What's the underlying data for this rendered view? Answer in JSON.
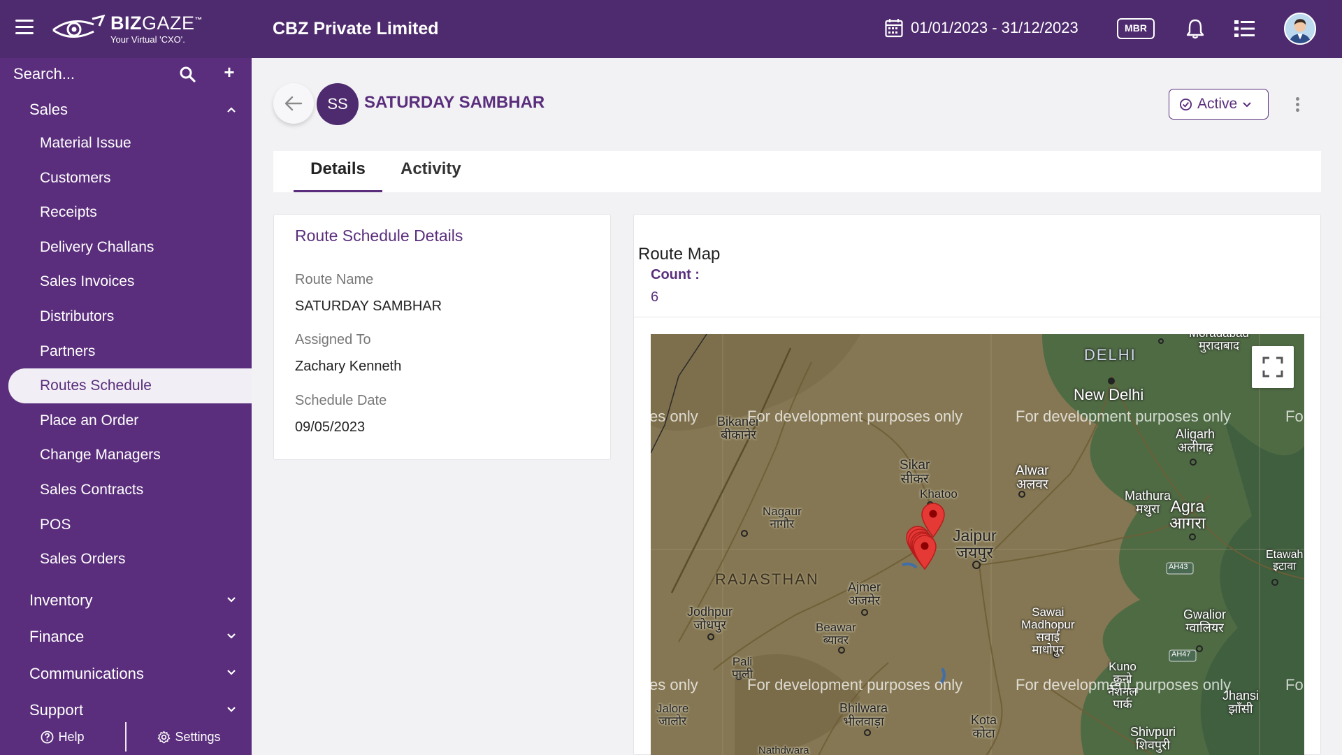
{
  "header": {
    "brand_main": "BIZ",
    "brand_light": "GAZE",
    "brand_tm": "™",
    "brand_tagline": "Your Virtual 'CXO'.",
    "company": "CBZ Private Limited",
    "date_range": "01/01/2023 - 31/12/2023",
    "mbr_badge": "MBR"
  },
  "sidebar": {
    "search_placeholder": "Search...",
    "plus_label": "+",
    "groups": [
      {
        "label": "Sales",
        "expanded": true
      },
      {
        "label": "Inventory",
        "expanded": false
      },
      {
        "label": "Finance",
        "expanded": false
      },
      {
        "label": "Communications",
        "expanded": false
      },
      {
        "label": "Support",
        "expanded": false
      }
    ],
    "sales_items": [
      "Material Issue",
      "Customers",
      "Receipts",
      "Delivery Challans",
      "Sales Invoices",
      "Distributors",
      "Partners",
      "Routes Schedule",
      "Place an Order",
      "Change Managers",
      "Sales Contracts",
      "POS",
      "Sales Orders"
    ],
    "active_item": "Routes Schedule",
    "footer": {
      "help": "Help",
      "settings": "Settings"
    }
  },
  "record": {
    "initials": "SS",
    "title": "SATURDAY SAMBHAR",
    "status": "Active"
  },
  "tabs": [
    {
      "label": "Details",
      "active": true
    },
    {
      "label": "Activity",
      "active": false
    }
  ],
  "details": {
    "card_title": "Route Schedule Details",
    "fields": [
      {
        "label": "Route Name",
        "value": "SATURDAY SAMBHAR"
      },
      {
        "label": "Assigned To",
        "value": "Zachary Kenneth"
      },
      {
        "label": "Schedule Date",
        "value": "09/05/2023"
      }
    ]
  },
  "map_panel": {
    "title": "Route Map",
    "count_label": "Count :",
    "count_value": "6",
    "watermark": "For development purposes only",
    "watermark_left_partial": "es only",
    "watermark_right_partial": "Fo",
    "places": {
      "delhi": "DELHI",
      "new_delhi": "New Delhi",
      "bikaner": "Bikaner\nबीकानेर",
      "aligarh": "Aligarh\nअलीगढ़",
      "sikar": "Sikar\nसीकर",
      "khatoo": "Khatoo",
      "alwar": "Alwar\nअलवर",
      "mathura": "Mathura\nमथुरा",
      "agra": "Agra\nआगरा",
      "nagaur": "Nagaur\nनागौर",
      "jaipur": "Jaipur\nजयपुर",
      "etawah": "Etawah\nइटावा",
      "rajasthan": "RAJASTHAN",
      "ajmer": "Ajmer\nअजमेर",
      "jodhpur": "Jodhpur\nजोधपुर",
      "beawar": "Beawar\nब्यावर",
      "sawai_madhopur": "Sawai\nMadhopur\nसवाई\nमाधोपुर",
      "gwalior": "Gwalior\nग्वालियर",
      "pali": "Pali\nपाली",
      "kuno": "Kuno\nकुनो\nनेशनल\nपार्क",
      "jhansi": "Jhansi\nझाँसी",
      "jalore": "Jalore\nजालोर",
      "bhilwara": "Bhilwara\nभीलवाड़ा",
      "kota": "Kota\nकोटा",
      "shivpuri": "Shivpuri\nशिवपुरी",
      "nathdwara": "Nathdwara",
      "moradabad": "Moradabad\nमुरादाबाद",
      "ah43": "AH43",
      "ah47": "AH47"
    }
  }
}
